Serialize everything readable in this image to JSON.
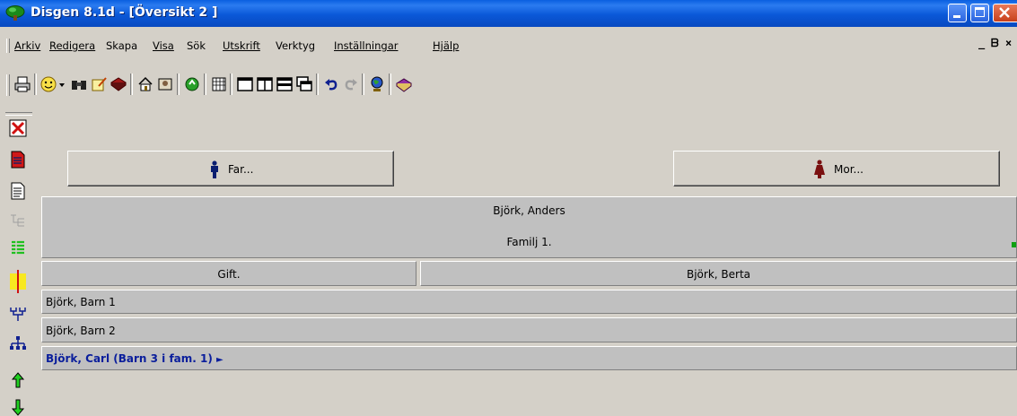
{
  "window": {
    "title": "Disgen 8.1d - [Översikt 2 ]"
  },
  "menu": {
    "items": [
      "Arkiv",
      "Redigera",
      "Skapa",
      "Visa",
      "Sök",
      "Utskrift",
      "Verktyg",
      "Inställningar",
      "Hjälp"
    ],
    "mdi_controls": [
      "_",
      "ᗷ",
      "×"
    ]
  },
  "toolbar": {
    "icons": [
      "printer-icon",
      "face-icon",
      "dropdown-arrow-icon",
      "binoculars-icon",
      "notes-icon",
      "book-red-icon",
      "home-icon",
      "photo-icon",
      "refresh-icon",
      "calendar-icon",
      "view-single-icon",
      "view-split-icon",
      "view-horizontal-icon",
      "view-cascade-icon",
      "undo-icon",
      "redo-icon",
      "globe-icon",
      "book-purple-icon"
    ]
  },
  "left_toolbar": {
    "icons": [
      "close-x-icon",
      "red-document-icon",
      "document-icon",
      "tree-disabled-icon",
      "green-list-icon",
      "yellow-list-icon",
      "ancestor-tree-icon",
      "descendant-tree-icon",
      "up-arrow-icon",
      "down-arrow-icon"
    ]
  },
  "overview": {
    "father_button": "Far...",
    "mother_button": "Mor...",
    "person": "Björk, Anders",
    "family": "Familj 1.",
    "relation": "Gift.",
    "spouse": "Björk, Berta",
    "children": [
      {
        "name": "Björk, Barn 1"
      },
      {
        "name": "Björk, Barn 2"
      },
      {
        "name": "Björk, Carl (Barn 3 i fam. 1)",
        "highlighted": true,
        "arrow": "►"
      }
    ]
  },
  "colors": {
    "title_bar": "#0a58d8",
    "highlight_text": "#0a1e9c",
    "panel_gray": "#c0c0c0"
  }
}
